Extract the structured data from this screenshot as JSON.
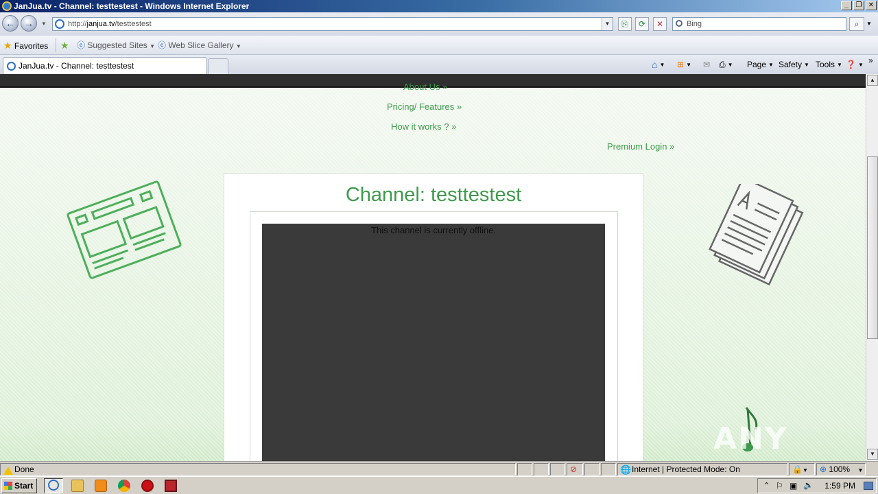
{
  "window": {
    "title": "JanJua.tv - Channel: testtestest - Windows Internet Explorer"
  },
  "address": {
    "scheme": "http://",
    "host": "janjua.tv",
    "path": "/testtestest"
  },
  "search": {
    "placeholder": "Bing"
  },
  "favorites": {
    "favorites_label": "Favorites",
    "suggested_sites": "Suggested Sites",
    "web_slice_gallery": "Web Slice Gallery"
  },
  "tab": {
    "title": "JanJua.tv - Channel: testtestest"
  },
  "commands": {
    "page": "Page",
    "safety": "Safety",
    "tools": "Tools"
  },
  "site": {
    "nav": {
      "about": "About Us »",
      "pricing": "Pricing/ Features »",
      "how": "How it works ? »",
      "login": "Premium Login »"
    },
    "channel_title": "Channel: testtestest",
    "offline_message": "This channel is currently offline."
  },
  "watermark": "ANY RUN",
  "status": {
    "text": "Done",
    "zone": "Internet | Protected Mode: On",
    "zoom": "100%"
  },
  "taskbar": {
    "start": "Start",
    "clock": "1:59 PM"
  },
  "colors": {
    "accent_green": "#3e9a4c",
    "player_bg": "#3a3a3a",
    "title_blue": "#0a246a"
  }
}
